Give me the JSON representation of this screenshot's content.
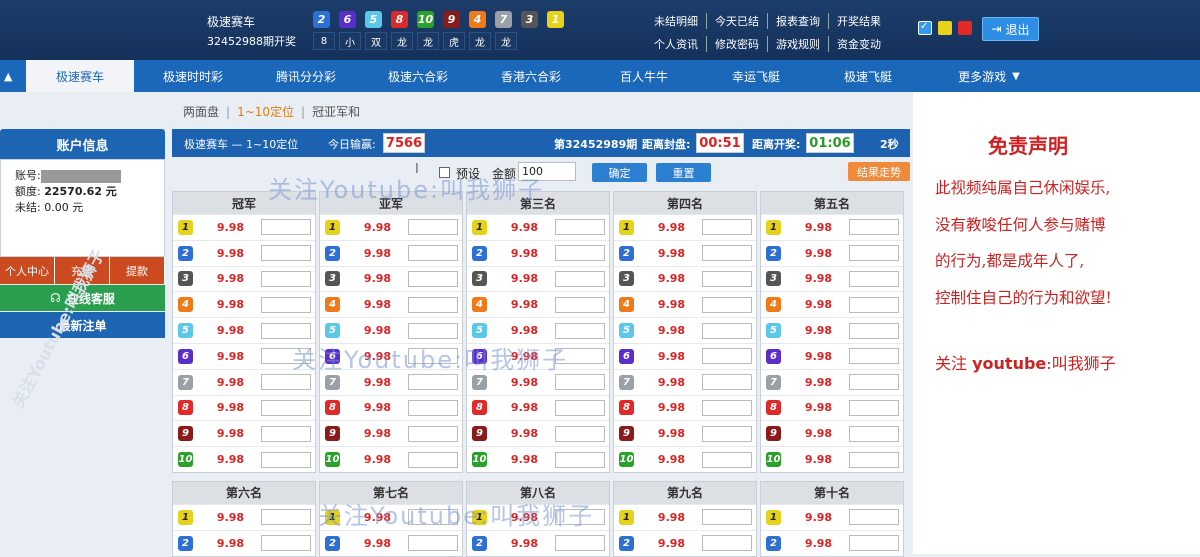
{
  "header": {
    "game_title": "极速赛车",
    "period_label": "32452988期开奖",
    "result_balls": [
      {
        "num": "2",
        "color": "#2e6fd3"
      },
      {
        "num": "6",
        "color": "#5a2ec8"
      },
      {
        "num": "5",
        "color": "#5cc8e8"
      },
      {
        "num": "8",
        "color": "#e02a2a"
      },
      {
        "num": "10",
        "color": "#2aa12a"
      },
      {
        "num": "9",
        "color": "#8b1a1a"
      },
      {
        "num": "4",
        "color": "#f07a1a"
      },
      {
        "num": "7",
        "color": "#9aa0a6"
      },
      {
        "num": "3",
        "color": "#555555"
      },
      {
        "num": "1",
        "color": "#e6d21a"
      }
    ],
    "result_stats": [
      "8",
      "小",
      "双",
      "龙",
      "龙",
      "虎",
      "龙",
      "龙"
    ],
    "links": [
      "未结明细",
      "今天已结",
      "报表查询",
      "开奖结果",
      "个人资讯",
      "修改密码",
      "游戏规则",
      "资金变动"
    ],
    "theme_colors": [
      "#3399ee",
      "#e8d21a",
      "#e02a2a"
    ],
    "logout_label": "退出"
  },
  "nav": {
    "items": [
      "极速赛车",
      "极速时时彩",
      "腾讯分分彩",
      "极速六合彩",
      "香港六合彩",
      "百人牛牛",
      "幸运飞艇",
      "极速飞艇",
      "更多游戏"
    ],
    "active_index": 0
  },
  "subtabs": {
    "items": [
      "两面盘",
      "1~10定位",
      "冠亚军和"
    ],
    "active_index": 1
  },
  "account": {
    "title": "账户信息",
    "account_label": "账号:",
    "quota_label": "额度:",
    "quota_value": "22570.62 元",
    "unsettled_label": "未结:",
    "unsettled_value": "0.00 元",
    "buttons": [
      "个人中心",
      "充值",
      "提款"
    ],
    "service_label": "在线客服",
    "recent_label": "最新注单"
  },
  "infobar": {
    "title": "极速赛车 — 1~10定位",
    "today_label": "今日输赢:",
    "today_value": "7566",
    "period": "第32452989期",
    "close_label": "距离封盘:",
    "close_time": "00:51",
    "draw_label": "距离开奖:",
    "draw_time": "01:06",
    "refresh": "2秒"
  },
  "controls": {
    "preset_label": "预设",
    "amount_label": "金额",
    "amount_value": "100",
    "confirm_label": "确定",
    "reset_label": "重置",
    "trend_label": "结果走势"
  },
  "odds": "9.98",
  "grid1": [
    "冠军",
    "亚军",
    "第三名",
    "第四名",
    "第五名"
  ],
  "grid2": [
    "第六名",
    "第七名",
    "第八名",
    "第九名",
    "第十名"
  ],
  "disclaimer": {
    "title": "免责声明",
    "lines": [
      "此视频纯属自己休闲娱乐,",
      "没有教唆任何人参与赌博",
      "的行为,都是成年人了,",
      "控制住自己的行为和欲望!"
    ],
    "follow_prefix": "关注",
    "follow_brand": "youtube",
    "follow_suffix": ":叫我狮子"
  },
  "watermarks": {
    "main": "关注Youtube:叫我狮子",
    "side": "关注Youtube:叫我狮子"
  }
}
